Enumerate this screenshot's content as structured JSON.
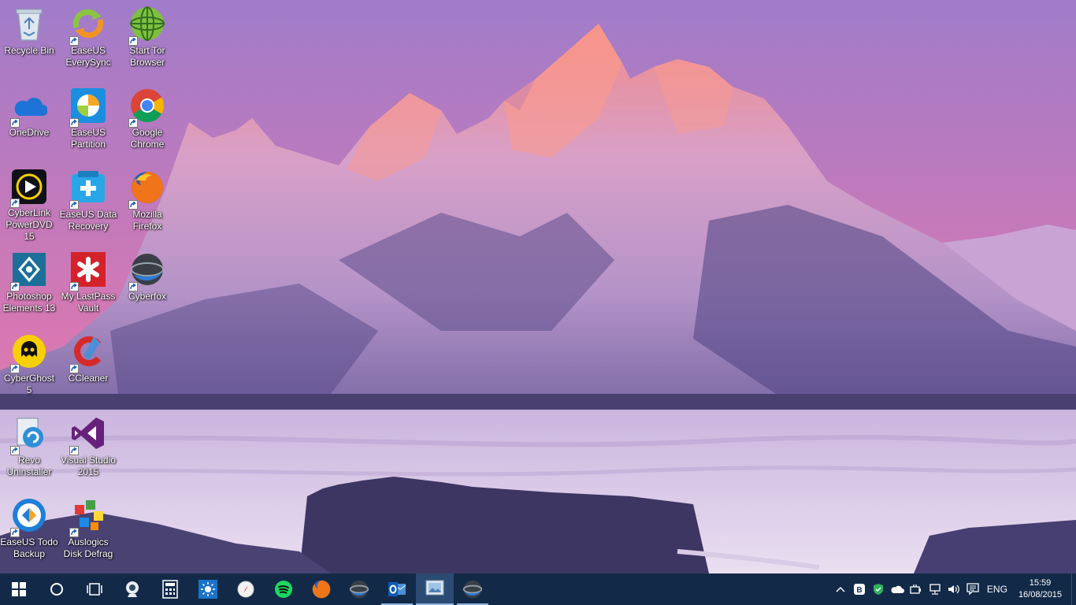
{
  "desktop": {
    "icons": [
      {
        "label": "Recycle Bin",
        "icon": "recycle-bin-icon",
        "shortcut": false
      },
      {
        "label": "EaseUS\nEverySync",
        "icon": "easeus-everysync-icon",
        "shortcut": true
      },
      {
        "label": "Start Tor\nBrowser",
        "icon": "tor-browser-icon",
        "shortcut": true
      },
      {
        "label": "OneDrive",
        "icon": "onedrive-icon",
        "shortcut": true
      },
      {
        "label": "EaseUS\nPartition",
        "icon": "easeus-partition-icon",
        "shortcut": true
      },
      {
        "label": "Google\nChrome",
        "icon": "chrome-icon",
        "shortcut": true
      },
      {
        "label": "CyberLink\nPowerDVD 15",
        "icon": "powerdvd-icon",
        "shortcut": true
      },
      {
        "label": "EaseUS Data\nRecovery",
        "icon": "easeus-data-recovery-icon",
        "shortcut": true
      },
      {
        "label": "Mozilla\nFirefox",
        "icon": "firefox-icon",
        "shortcut": true
      },
      {
        "label": "Photoshop\nElements 13",
        "icon": "photoshop-elements-icon",
        "shortcut": true
      },
      {
        "label": "My LastPass\nVault",
        "icon": "lastpass-icon",
        "shortcut": true
      },
      {
        "label": "Cyberfox",
        "icon": "cyberfox-icon",
        "shortcut": true
      },
      {
        "label": "CyberGhost 5",
        "icon": "cyberghost-icon",
        "shortcut": true
      },
      {
        "label": "CCleaner",
        "icon": "ccleaner-icon",
        "shortcut": true
      },
      {
        "label": "Revo\nUninstaller",
        "icon": "revo-uninstaller-icon",
        "shortcut": true
      },
      {
        "label": "Visual Studio\n2015",
        "icon": "visual-studio-icon",
        "shortcut": true
      },
      {
        "label": "EaseUS Todo\nBackup",
        "icon": "easeus-todo-backup-icon",
        "shortcut": true
      },
      {
        "label": "Auslogics\nDisk Defrag",
        "icon": "auslogics-defrag-icon",
        "shortcut": true
      }
    ]
  },
  "taskbar": {
    "buttons": [
      {
        "name": "start-button",
        "icon": "windows-logo-icon"
      },
      {
        "name": "cortana-button",
        "icon": "cortana-circle-icon"
      },
      {
        "name": "task-view-button",
        "icon": "task-view-icon"
      },
      {
        "name": "taskbar-webcam-app",
        "icon": "webcam-icon"
      },
      {
        "name": "taskbar-calculator",
        "icon": "calculator-icon"
      },
      {
        "name": "taskbar-weather",
        "icon": "weather-sun-icon"
      },
      {
        "name": "taskbar-compass-app",
        "icon": "compass-icon"
      },
      {
        "name": "taskbar-spotify",
        "icon": "spotify-icon"
      },
      {
        "name": "taskbar-firefox",
        "icon": "firefox-icon"
      },
      {
        "name": "taskbar-cyberfox",
        "icon": "cyberfox-icon"
      },
      {
        "name": "taskbar-outlook",
        "icon": "outlook-icon"
      },
      {
        "name": "taskbar-photo-viewer",
        "icon": "photo-viewer-icon"
      },
      {
        "name": "taskbar-cyberfox-2",
        "icon": "cyberfox-icon"
      }
    ],
    "active_button": "taskbar-photo-viewer",
    "running_buttons": [
      "taskbar-outlook",
      "taskbar-photo-viewer",
      "taskbar-cyberfox-2"
    ],
    "tray": {
      "icons": [
        "chevron-up-icon",
        "bitdefender-icon",
        "shield-icon",
        "onedrive-cloud-icon",
        "power-plug-icon",
        "network-icon",
        "volume-icon",
        "action-center-icon"
      ],
      "language": "ENG",
      "time": "15:59",
      "date": "16/08/2015"
    },
    "color": "#122a48"
  },
  "colors": {
    "sky_top": "#9b6cc2",
    "sky_bottom": "#e27aa8",
    "snow": "#e9dcef",
    "forest": "#3a3660"
  }
}
